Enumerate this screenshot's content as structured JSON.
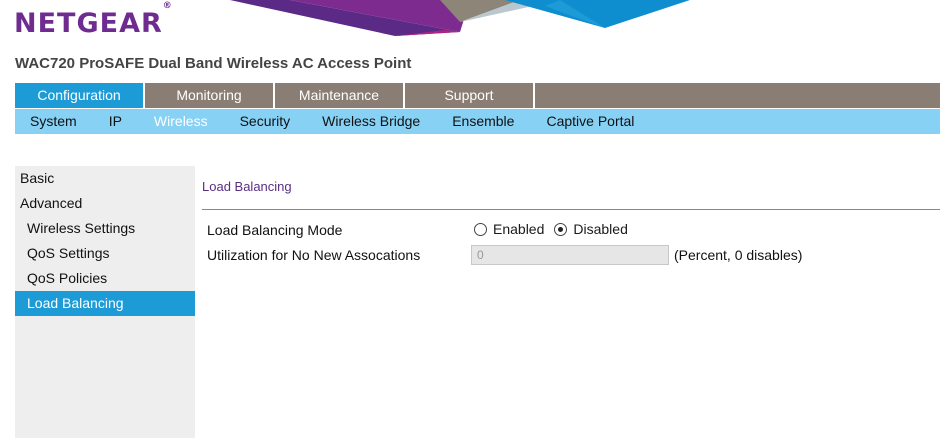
{
  "brand": {
    "logo_text": "NETGEAR",
    "logo_mark": "®",
    "product_title": "WAC720 ProSAFE Dual Band Wireless AC Access Point"
  },
  "top_tabs": [
    {
      "label": "Configuration",
      "active": true
    },
    {
      "label": "Monitoring",
      "active": false
    },
    {
      "label": "Maintenance",
      "active": false
    },
    {
      "label": "Support",
      "active": false
    }
  ],
  "sub_tabs": [
    {
      "label": "System",
      "active": false
    },
    {
      "label": "IP",
      "active": false
    },
    {
      "label": "Wireless",
      "active": true
    },
    {
      "label": "Security",
      "active": false
    },
    {
      "label": "Wireless Bridge",
      "active": false
    },
    {
      "label": "Ensemble",
      "active": false
    },
    {
      "label": "Captive Portal",
      "active": false
    }
  ],
  "sidebar": [
    {
      "label": "Basic",
      "active": false
    },
    {
      "label": "Advanced",
      "active": false
    },
    {
      "label": "Wireless Settings",
      "active": false
    },
    {
      "label": "QoS Settings",
      "active": false
    },
    {
      "label": "QoS Policies",
      "active": false
    },
    {
      "label": "Load Balancing",
      "active": true
    }
  ],
  "content": {
    "title": "Load Balancing",
    "mode_label": "Load Balancing Mode",
    "mode_options": {
      "enabled": "Enabled",
      "disabled": "Disabled"
    },
    "mode_value": "Disabled",
    "util_label": "Utilization for No New Assocations",
    "util_value": "0",
    "util_note": "(Percent, 0 disables)"
  },
  "colors": {
    "brand_purple": "#6e2c91",
    "topnav_bg": "#8a7d73",
    "active_blue": "#1d9bd7",
    "subnav_bg": "#87d1f5",
    "sidebar_bg": "#eeeeee",
    "title_purple": "#5a2e82"
  }
}
